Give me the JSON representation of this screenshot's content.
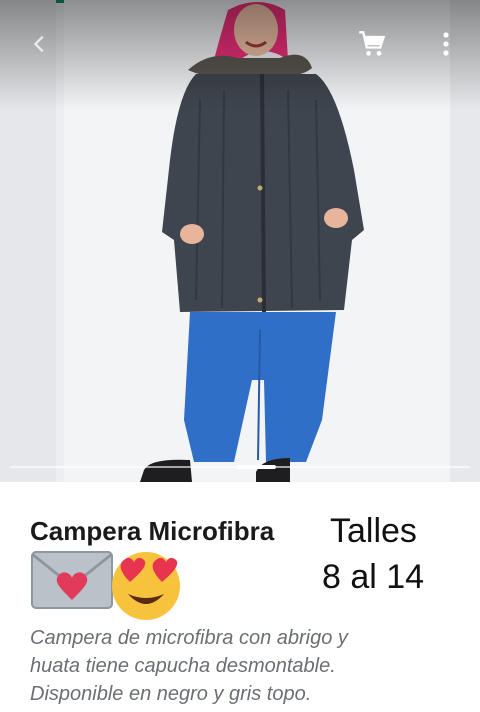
{
  "toolbar": {
    "back_icon": "arrow-back-icon",
    "cart_icon": "shopping-cart-icon",
    "menu_icon": "more-vertical-icon",
    "accent": "#1f8a73"
  },
  "product": {
    "title": "Campera Microfibra",
    "emojis": [
      "love-letter-emoji",
      "heart-eyes-emoji"
    ],
    "sizes_line1": "Talles",
    "sizes_line2": "8 al 14",
    "description_lines": [
      "Campera de microfibra con abrigo y",
      "huata tiene capucha desmontable.",
      "Disponible en negro y gris topo."
    ]
  },
  "colors": {
    "jacket": "#3f454e",
    "jeans": "#2f6fc7",
    "hair": "#ee2f7a"
  }
}
